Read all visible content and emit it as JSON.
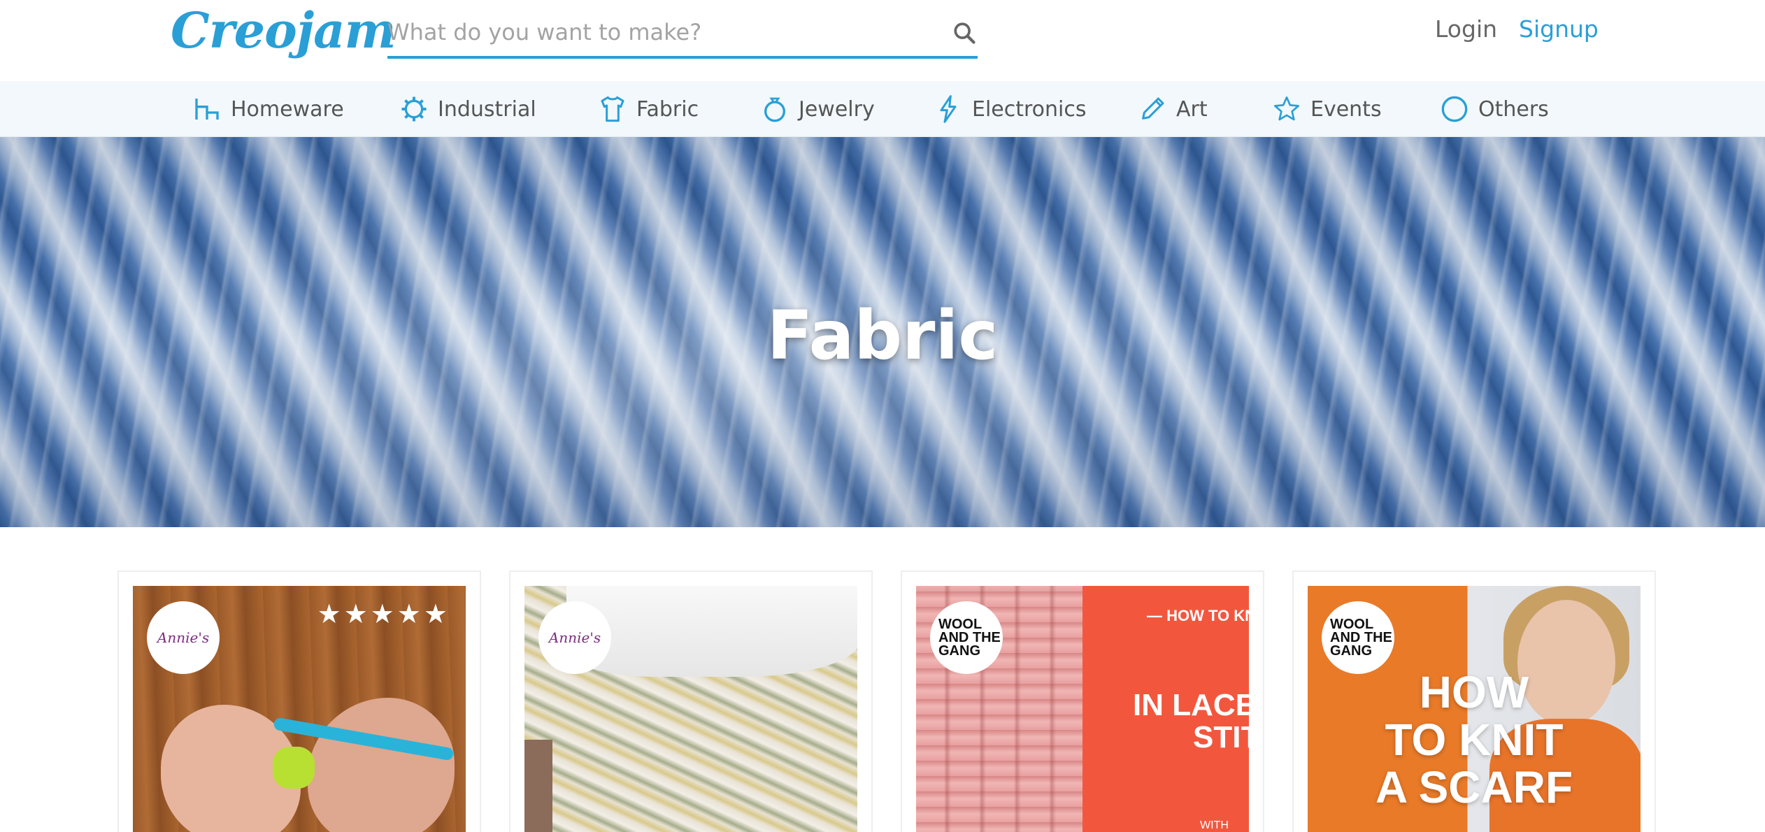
{
  "header": {
    "logo_text": "Creojam",
    "search_placeholder": "What do you want to make?",
    "login_label": "Login",
    "signup_label": "Signup"
  },
  "categories": [
    {
      "label": "Homeware",
      "icon": "homeware-icon"
    },
    {
      "label": "Industrial",
      "icon": "gear-icon"
    },
    {
      "label": "Fabric",
      "icon": "shirt-icon"
    },
    {
      "label": "Jewelry",
      "icon": "ring-icon"
    },
    {
      "label": "Electronics",
      "icon": "lightning-icon"
    },
    {
      "label": "Art",
      "icon": "pencil-icon"
    },
    {
      "label": "Events",
      "icon": "star-icon"
    },
    {
      "label": "Others",
      "icon": "circle-icon"
    }
  ],
  "hero": {
    "title": "Fabric"
  },
  "cards": [
    {
      "badge": "Annie's",
      "stars": "★★★★★"
    },
    {
      "badge": "Annie's"
    },
    {
      "badge": "WOOL AND THE GANG",
      "text_top": "— HOW TO KNI",
      "text_mid1": "IN LACE",
      "text_mid2": "STITCH",
      "text_bottom": "WITH"
    },
    {
      "badge": "WOOL AND THE GANG",
      "text_main1": "HOW",
      "text_main2": "TO KNIT",
      "text_main3": "A SCARF"
    }
  ],
  "colors": {
    "accent": "#2a9fd6",
    "nav_bg": "#f2f8fb"
  }
}
